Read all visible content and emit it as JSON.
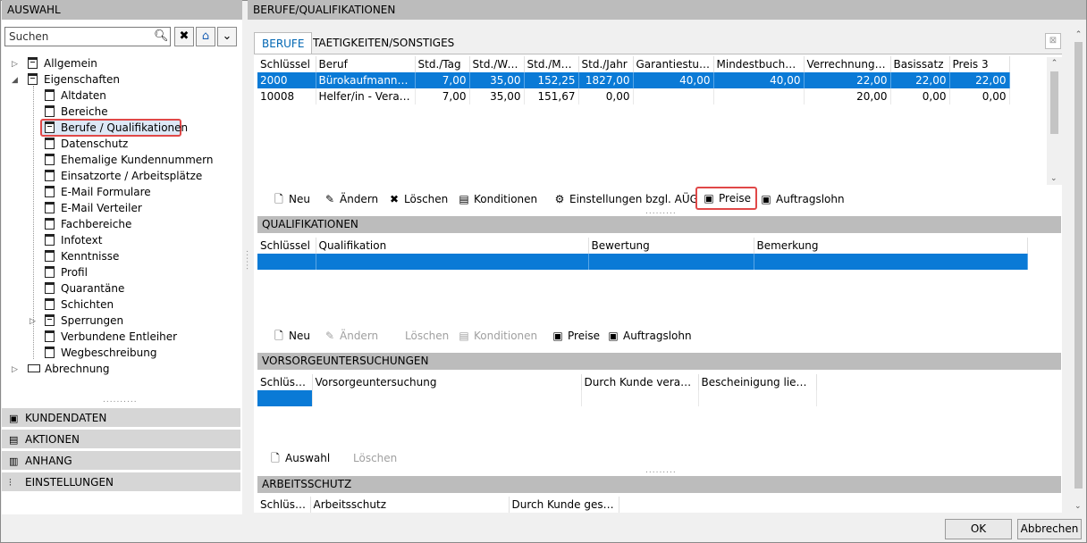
{
  "left_panel": {
    "title": "AUSWAHL",
    "search_placeholder": "Suchen",
    "tree": {
      "allgemein": "Allgemein",
      "eigenschaften": "Eigenschaften",
      "children": [
        "Altdaten",
        "Bereiche",
        "Berufe / Qualifikationen",
        "Datenschutz",
        "Ehemalige Kundennummern",
        "Einsatzorte / Arbeitsplätze",
        "E-Mail Formulare",
        "E-Mail Verteiler",
        "Fachbereiche",
        "Infotext",
        "Kenntnisse",
        "Profil",
        "Quarantäne",
        "Schichten",
        "Sperrungen",
        "Verbundene Entleiher",
        "Wegbeschreibung"
      ],
      "abrechnung": "Abrechnung"
    },
    "nav": [
      "KUNDENDATEN",
      "AKTIONEN",
      "ANHANG",
      "EINSTELLUNGEN"
    ]
  },
  "right_panel": {
    "title": "BERUFE/QUALIFIKATIONEN",
    "tabs": [
      "BERUFE",
      "TAETIGKEITEN/SONSTIGES"
    ],
    "berufe_table": {
      "columns": [
        "Schlüssel",
        "Beruf",
        "Std./Tag",
        "Std./Woc...",
        "Std./Mo...",
        "Std./Jahr",
        "Garantiestunden",
        "Mindestbuchung",
        "Verrechnungssatz",
        "Basissatz",
        "Preis 3"
      ],
      "rows": [
        [
          "2000",
          "Bürokaufmann/-fr...",
          "7,00",
          "35,00",
          "152,25",
          "1827,00",
          "40,00",
          "40,00",
          "22,00",
          "22,00",
          "22,00"
        ],
        [
          "10008",
          "Helfer/in - Veranst...",
          "7,00",
          "35,00",
          "151,67",
          "0,00",
          "",
          "",
          "20,00",
          "0,00",
          "0,00"
        ]
      ]
    },
    "berufe_toolbar": {
      "neu": "Neu",
      "aendern": "Ändern",
      "loeschen": "Löschen",
      "konditionen": "Konditionen",
      "einstellungen": "Einstellungen bzgl. AÜG",
      "preise": "Preise",
      "auftragslohn": "Auftragslohn"
    },
    "qualifikationen": {
      "title": "QUALIFIKATIONEN",
      "columns": [
        "Schlüssel",
        "Qualifikation",
        "Bewertung",
        "Bemerkung"
      ],
      "toolbar": {
        "neu": "Neu",
        "aendern": "Ändern",
        "loeschen": "Löschen",
        "konditionen": "Konditionen",
        "preise": "Preise",
        "auftragslohn": "Auftragslohn"
      }
    },
    "vorsorge": {
      "title": "VORSORGEUNTERSUCHUNGEN",
      "columns": [
        "Schlüssel",
        "Vorsorgeuntersuchung",
        "Durch Kunde veranlasst",
        "Bescheinigung liegt vor"
      ],
      "toolbar": {
        "auswahl": "Auswahl",
        "loeschen": "Löschen"
      }
    },
    "arbeitsschutz": {
      "title": "ARBEITSSCHUTZ",
      "columns": [
        "Schlüssel",
        "Arbeitsschutz",
        "Durch Kunde gestellt"
      ]
    }
  },
  "footer": {
    "ok": "OK",
    "abbrechen": "Abbrechen"
  }
}
